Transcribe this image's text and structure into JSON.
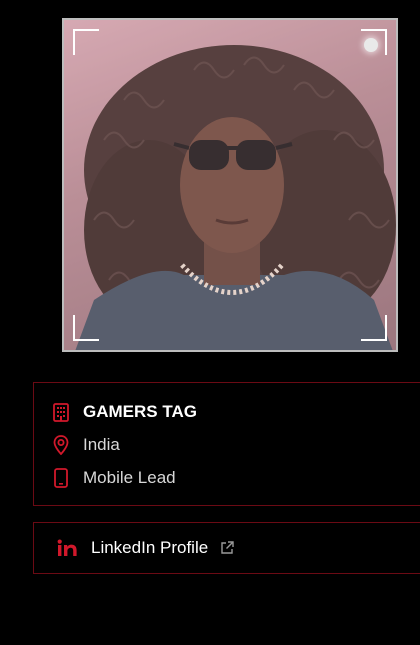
{
  "profile": {
    "photo_alt": "profile photo",
    "company": "GAMERS TAG",
    "location": "India",
    "role": "Mobile Lead"
  },
  "links": {
    "linkedin_label": "LinkedIn Profile"
  },
  "icons": {
    "company": "building-icon",
    "location": "map-pin-icon",
    "role": "smartphone-icon",
    "linkedin": "linkedin-icon",
    "external": "external-link-icon"
  },
  "colors": {
    "accent": "#d1182b",
    "card_border": "#6b0a14",
    "background": "#000000"
  }
}
